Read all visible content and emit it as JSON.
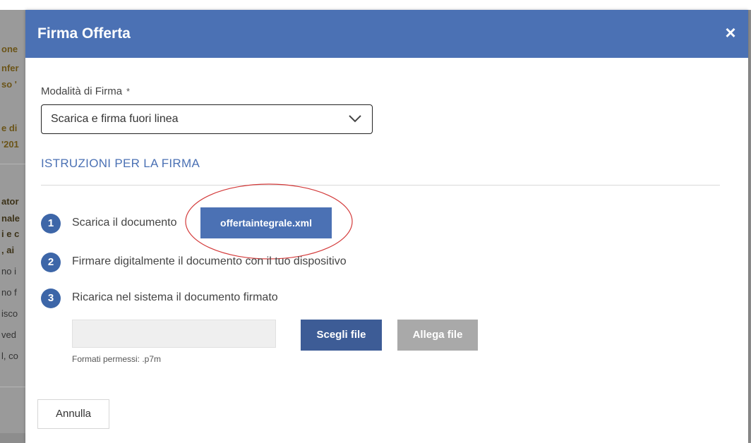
{
  "background": {
    "fragments": [
      {
        "text": "one",
        "style": "brown"
      },
      {
        "text": "nfer",
        "style": "brown"
      },
      {
        "text": "so '",
        "style": "brown"
      },
      {
        "text": "e di",
        "style": "brown"
      },
      {
        "text": "'201",
        "style": "brown"
      },
      {
        "text": "ator",
        "style": "bold"
      },
      {
        "text": "nale",
        "style": "bold"
      },
      {
        "text": "i e c",
        "style": "bold"
      },
      {
        "text": ", ai",
        "style": "bold"
      },
      {
        "text": "no i",
        "style": "light"
      },
      {
        "text": "no f",
        "style": "light"
      },
      {
        "text": "isco",
        "style": "light"
      },
      {
        "text": "ved",
        "style": "light"
      },
      {
        "text": "l, co",
        "style": "light"
      }
    ]
  },
  "modal": {
    "title": "Firma Offerta",
    "close_icon": "×"
  },
  "form": {
    "label": "Modalità di Firma",
    "required_mark": "*",
    "selected_value": "Scarica e firma fuori linea"
  },
  "instructions": {
    "heading": "ISTRUZIONI PER LA FIRMA",
    "steps": [
      {
        "number": "1",
        "text": "Scarica il documento"
      },
      {
        "number": "2",
        "text": "Firmare digitalmente il documento con il tuo dispositivo"
      },
      {
        "number": "3",
        "text": "Ricarica nel sistema il documento firmato"
      }
    ],
    "download_label": "offertaintegrale.xml"
  },
  "upload": {
    "choose_label": "Scegli file",
    "attach_label": "Allega file",
    "formats_text": "Formati permessi: .p7m"
  },
  "footer": {
    "cancel_label": "Annulla"
  },
  "colors": {
    "header": "#4b71b4",
    "step_badge": "#3d66a8",
    "choose_button": "#3d5c96",
    "attach_button_disabled": "#a9a9a9",
    "annotation_ellipse": "#d33a3a"
  }
}
